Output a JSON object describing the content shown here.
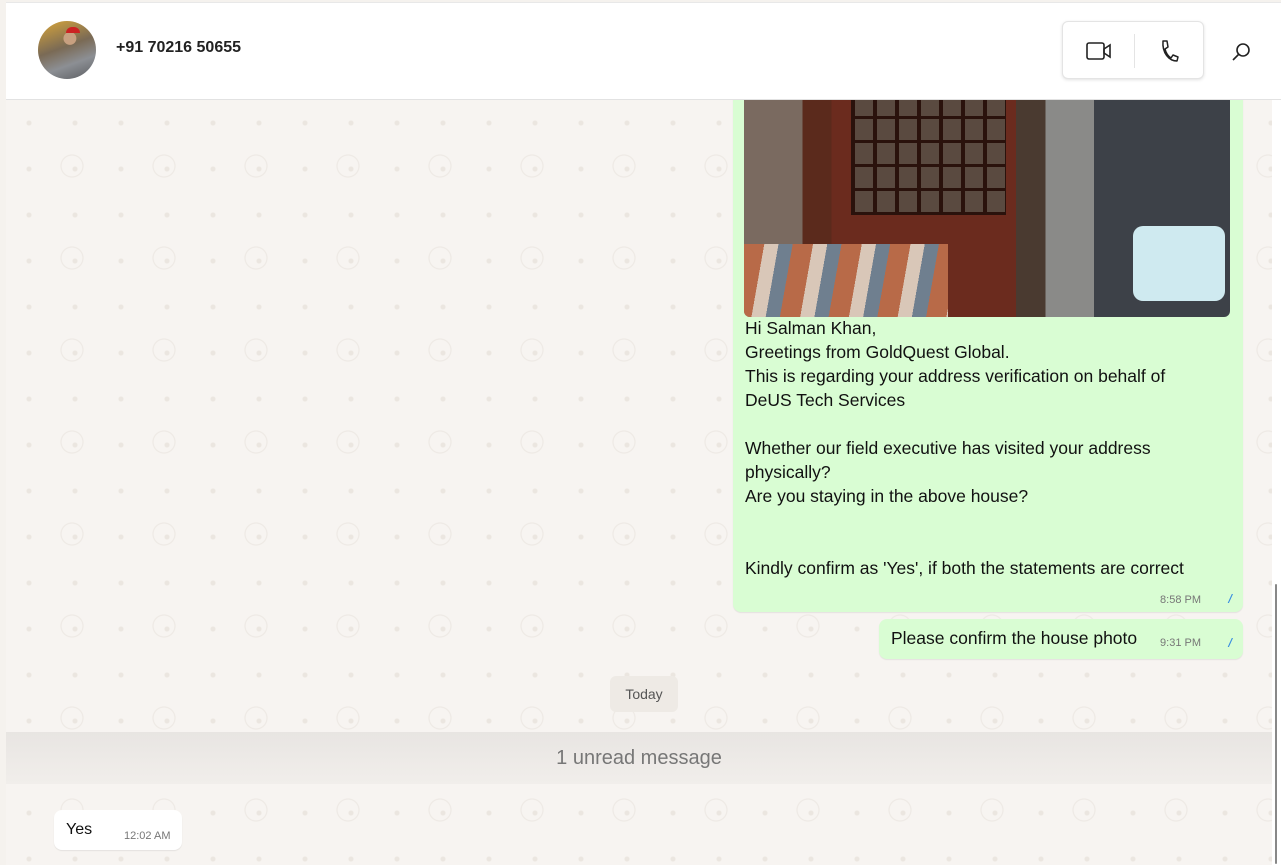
{
  "header": {
    "contact_name": "+91 70216 50655"
  },
  "icons": {
    "video": "video-camera-icon",
    "call": "phone-icon",
    "search": "search-icon"
  },
  "messages": [
    {
      "direction": "out",
      "type": "image-with-caption",
      "text": "Hi Salman Khan,\nGreetings from GoldQuest Global.\nThis is regarding your address verification on behalf of\nDeUS Tech Services\n\nWhether our field executive has visited your address\nphysically?\nAre you staying in the above house?\n\n\nKindly confirm as 'Yes', if both the statements are correct",
      "time": "8:58 PM",
      "status": "read"
    },
    {
      "direction": "out",
      "text": "Please confirm the house photo",
      "time": "9:31 PM",
      "status": "read"
    },
    {
      "direction": "in",
      "text": "Yes",
      "time": "12:02 AM"
    }
  ],
  "date_divider": "Today",
  "unread_divider": "1 unread message",
  "colors": {
    "outgoing": "#d9fdd3",
    "read_ticks": "#3b8ee0"
  }
}
